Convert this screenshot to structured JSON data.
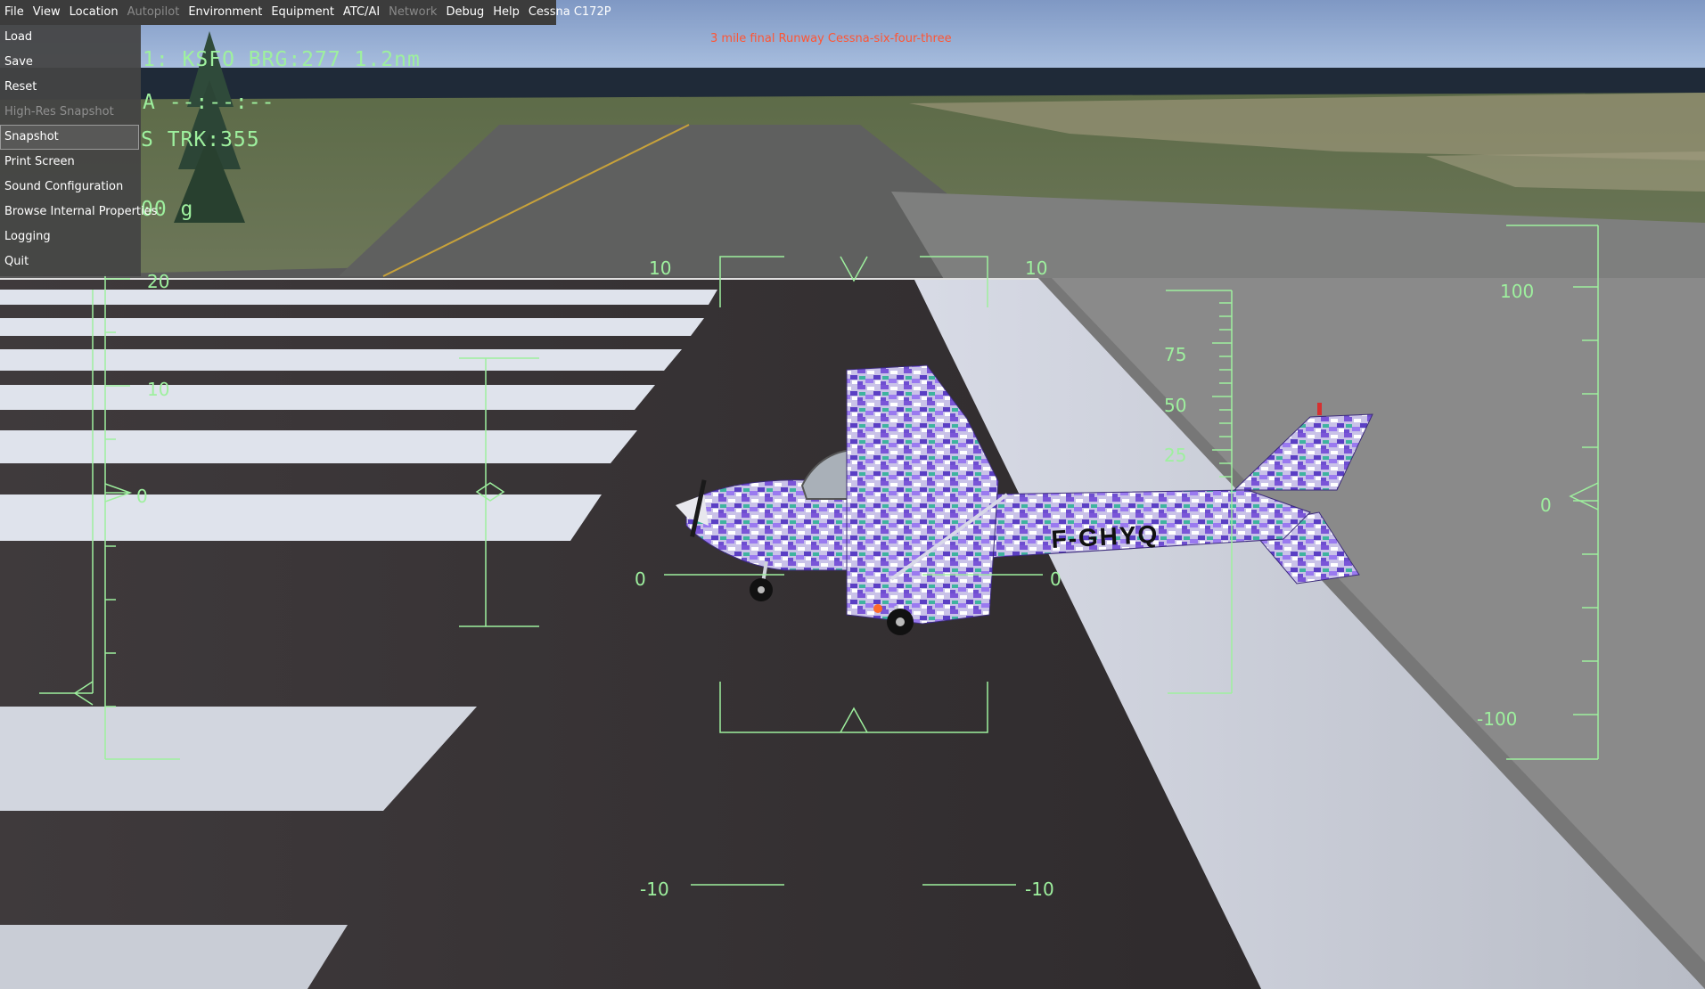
{
  "menubar": {
    "items": [
      {
        "label": "File",
        "enabled": true
      },
      {
        "label": "View",
        "enabled": true
      },
      {
        "label": "Location",
        "enabled": true
      },
      {
        "label": "Autopilot",
        "enabled": false
      },
      {
        "label": "Environment",
        "enabled": true
      },
      {
        "label": "Equipment",
        "enabled": true
      },
      {
        "label": "ATC/AI",
        "enabled": true
      },
      {
        "label": "Network",
        "enabled": false
      },
      {
        "label": "Debug",
        "enabled": true
      },
      {
        "label": "Help",
        "enabled": true
      },
      {
        "label": "Cessna C172P",
        "enabled": true
      }
    ]
  },
  "file_menu": {
    "items": [
      {
        "label": "Load",
        "enabled": true
      },
      {
        "label": "Save",
        "enabled": true
      },
      {
        "label": "Reset",
        "enabled": true
      },
      {
        "label": "High-Res Snapshot",
        "enabled": false
      },
      {
        "label": "Snapshot",
        "enabled": true,
        "selected": true
      },
      {
        "label": "Print Screen",
        "enabled": true
      },
      {
        "label": "Sound Configuration",
        "enabled": true
      },
      {
        "label": "Browse Internal Properties",
        "enabled": true
      },
      {
        "label": "Logging",
        "enabled": true
      },
      {
        "label": "Quit",
        "enabled": true
      }
    ]
  },
  "atc_message": "3 mile final Runway  Cessna-six-four-three",
  "hud": {
    "color": "#9ef09e",
    "wp_line": "1: KSFO BRG:277    1.2nm",
    "eta_line": "A --:--:--",
    "trk_line": "S TRK:355",
    "g_line": "00 g",
    "left_scale_labels": [
      "20",
      "10",
      "0"
    ],
    "pitch_labels": {
      "top_left": "10",
      "top_right": "10",
      "mid_left": "0",
      "mid_right": "0",
      "bottom_left": "-10",
      "bottom_right": "-10"
    },
    "inner_scale_labels": [
      "75",
      "50",
      "25"
    ],
    "right_scale_labels": [
      "100",
      "0",
      "-100"
    ]
  },
  "aircraft": {
    "registration": "F-GHYQ"
  }
}
